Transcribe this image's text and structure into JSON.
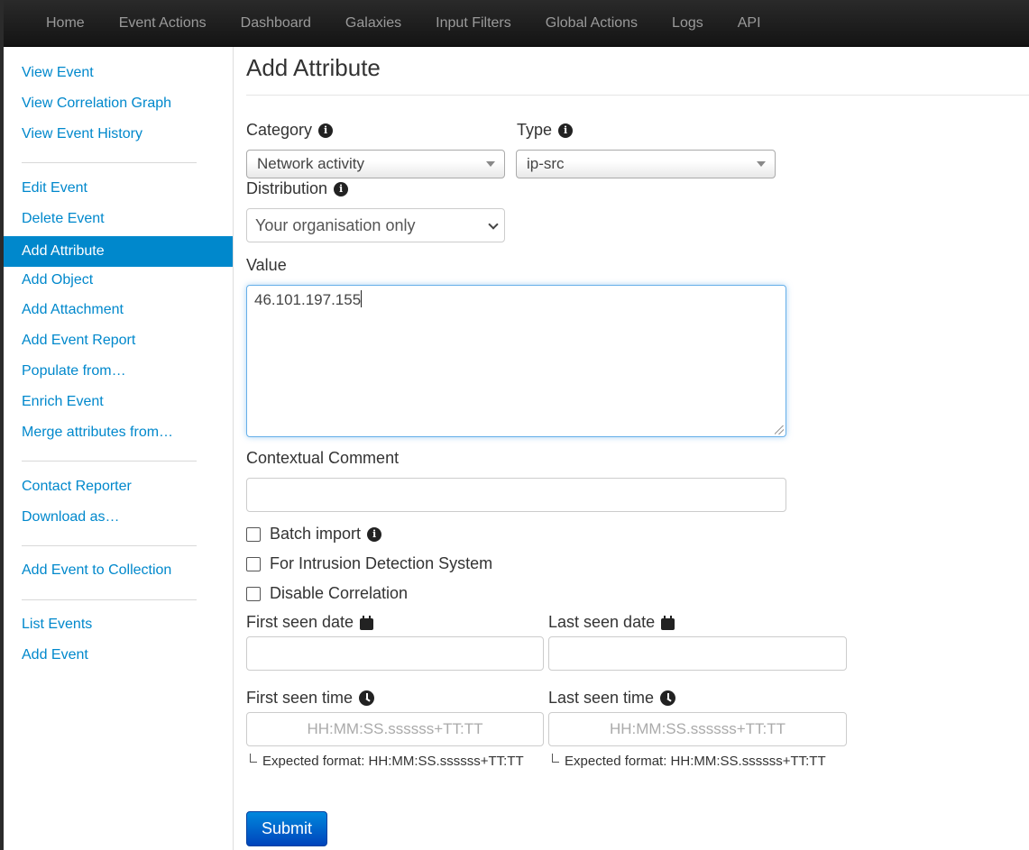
{
  "nav": {
    "items": [
      "Home",
      "Event Actions",
      "Dashboard",
      "Galaxies",
      "Input Filters",
      "Global Actions",
      "Logs",
      "API"
    ]
  },
  "sidebar": {
    "items": [
      "View Event",
      "View Correlation Graph",
      "View Event History",
      "Edit Event",
      "Delete Event",
      "Add Attribute",
      "Add Object",
      "Add Attachment",
      "Add Event Report",
      "Populate from…",
      "Enrich Event",
      "Merge attributes from…",
      "Contact Reporter",
      "Download as…",
      "Add Event to Collection",
      "List Events",
      "Add Event"
    ],
    "active": "Add Attribute"
  },
  "form": {
    "title": "Add Attribute",
    "category_label": "Category",
    "category_value": "Network activity",
    "type_label": "Type",
    "type_value": "ip-src",
    "distribution_label": "Distribution",
    "distribution_value": "Your organisation only",
    "value_label": "Value",
    "value_text": "46.101.197.155",
    "comment_label": "Contextual Comment",
    "comment_value": "",
    "batch_import_label": "Batch import",
    "ids_label": "For Intrusion Detection System",
    "disable_correlation_label": "Disable Correlation",
    "first_seen_date_label": "First seen date",
    "last_seen_date_label": "Last seen date",
    "first_seen_time_label": "First seen time",
    "last_seen_time_label": "Last seen time",
    "time_placeholder": "HH:MM:SS.ssssss+TT:TT",
    "time_hint": "Expected format: HH:MM:SS.ssssss+TT:TT",
    "submit_label": "Submit"
  },
  "colors": {
    "link": "#0088cc",
    "active_bg": "#0088cc",
    "submit": "#0055cc"
  }
}
